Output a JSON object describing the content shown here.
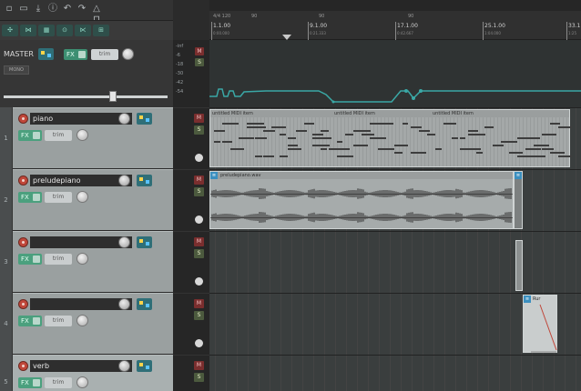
{
  "colors": {
    "accent": "#3aa8a6",
    "record": "#c0473a",
    "fx": "#4ba07e",
    "item": "#9a9e9e"
  },
  "toolbar": {
    "icons": [
      "new-project-icon",
      "open-project-icon",
      "save-project-icon",
      "project-settings-icon",
      "undo-icon",
      "redo-icon",
      "metronome-icon",
      "lock-icon"
    ]
  },
  "master": {
    "label": "MASTER",
    "fx_label": "FX",
    "trim_label": "trim",
    "mono_label": "MONO"
  },
  "master_meter": {
    "db_marks": [
      "-inf",
      "-6",
      "-18",
      "-30",
      "-42",
      "-54"
    ],
    "m_label": "M",
    "s_label": "S"
  },
  "ruler": {
    "bpm_tags": [
      "4/4  120",
      "90",
      "90",
      "90"
    ],
    "marks": [
      {
        "label": "1.1.00",
        "sub": "0:00.000"
      },
      {
        "label": "9.1.00",
        "sub": "0:21.333"
      },
      {
        "label": "17.1.00",
        "sub": "0:42.667"
      },
      {
        "label": "25.1.00",
        "sub": "1:04.000"
      },
      {
        "label": "33.1",
        "sub": "1:25"
      }
    ]
  },
  "tracks": [
    {
      "num": "1",
      "name": "piano"
    },
    {
      "num": "2",
      "name": "preludepiano"
    },
    {
      "num": "3",
      "name": ""
    },
    {
      "num": "4",
      "name": ""
    },
    {
      "num": "5",
      "name": "verb"
    }
  ],
  "track_controls": {
    "fx_label": "FX",
    "trim_label": "trim",
    "m_label": "M",
    "s_label": "S"
  },
  "items": {
    "midi_labels": [
      "untitled MIDI item",
      "untitled MIDI item",
      "untitled MIDI item"
    ],
    "audio_label": "preludepiano.wav",
    "verb_label": "Rur"
  }
}
